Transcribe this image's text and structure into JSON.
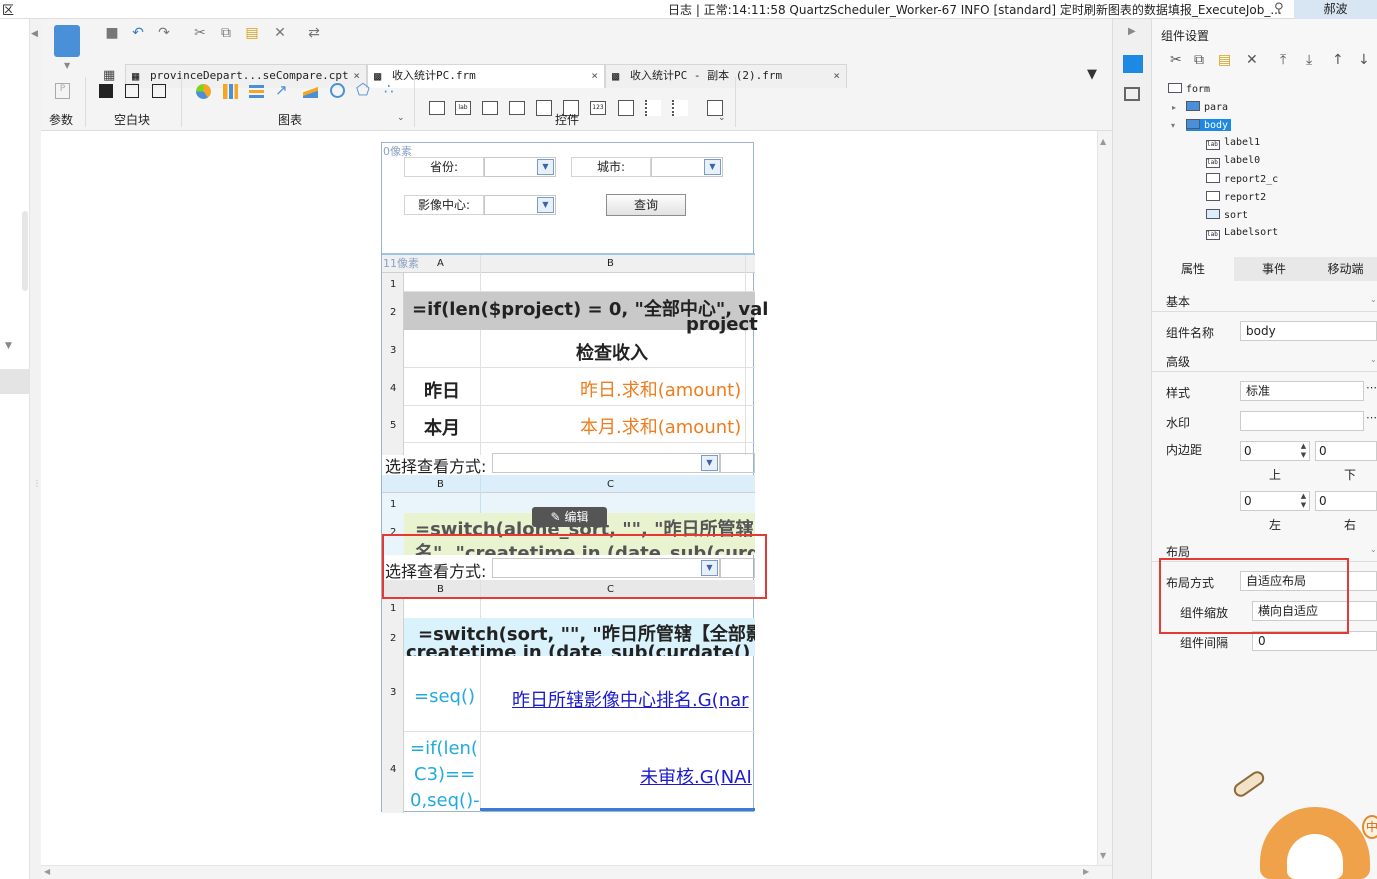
{
  "topbar": {
    "left_text": "区",
    "log_text": "日志 | 正常:14:11:58 QuartzScheduler_Worker-67 INFO [standard] 定时刷新图表的数据填报_ExecuteJob_...",
    "user": "郝波"
  },
  "tabs": [
    {
      "label": "provinceDepart...seCompare.cpt",
      "close": "×"
    },
    {
      "label": "收入统计PC.frm",
      "close": "×"
    },
    {
      "label": "收入统计PC - 副本 (2).frm",
      "close": "×"
    }
  ],
  "ribbon": {
    "groups": [
      "参数",
      "空白块",
      "图表",
      "控件"
    ]
  },
  "form": {
    "top_pixels": "0像素",
    "grid_pixels": "11像素",
    "labels": {
      "province": "省份:",
      "city": "城市:",
      "center": "影像中心:"
    },
    "query_button": "查询",
    "grid1": {
      "cols": [
        "A",
        "B"
      ],
      "rows": [
        "1",
        "2",
        "3",
        "4",
        "5"
      ],
      "r2": "=if(len($project) = 0, \"全部中心\", val",
      "r2b": "project",
      "r3": "检查收入",
      "r4a": "昨日",
      "r4b": "昨日.求和(amount)",
      "r5a": "本月",
      "r5b": "本月.求和(amount)"
    },
    "select_label": "选择查看方式:",
    "grid2": {
      "cols": [
        "B",
        "C"
      ],
      "rows": [
        "1",
        "2"
      ],
      "r2": "=switch(alone_sort, \"\", \"昨日所管辖【",
      "r2b": "名\", \"createtime in (date_sub(curda"
    },
    "edit_badge": "编辑",
    "select_label2": "选择查看方式:",
    "grid3": {
      "cols": [
        "B",
        "C"
      ],
      "rows": [
        "1",
        "2",
        "3",
        "4"
      ],
      "r2": "=switch(sort, \"\", \"昨日所管辖【全部影",
      "r2b": "createtime in (date_sub(curdate() in",
      "r3a": "=seq()",
      "r3b": "昨日所辖影像中心排名.G(nar",
      "r4a1": "=if(len(",
      "r4a2": "C3)==",
      "r4a3": "0,seq()-",
      "r4b": "未审核.G(NAI"
    }
  },
  "panel": {
    "title": "组件设置",
    "tree": [
      "form",
      "para",
      "body",
      "label1",
      "label0",
      "report2_c",
      "report2",
      "sort",
      "Labelsort"
    ],
    "tabs": [
      "属性",
      "事件",
      "移动端"
    ],
    "sections": {
      "basic": "基本",
      "advanced": "高级",
      "layout": "布局"
    },
    "props": {
      "name_label": "组件名称",
      "name_value": "body",
      "style_label": "样式",
      "style_value": "标准",
      "watermark_label": "水印",
      "padding_label": "内边距",
      "pad_top": "0",
      "pad_bottom": "0",
      "pad_left": "0",
      "pad_right": "0",
      "top": "上",
      "bottom": "下",
      "left": "左",
      "right": "右",
      "layout_label": "布局方式",
      "layout_value": "自适应布局",
      "scale_label": "组件缩放",
      "scale_value": "横向自适应",
      "gap_label": "组件间隔",
      "gap_value": "0"
    },
    "mascot_text": "中"
  }
}
